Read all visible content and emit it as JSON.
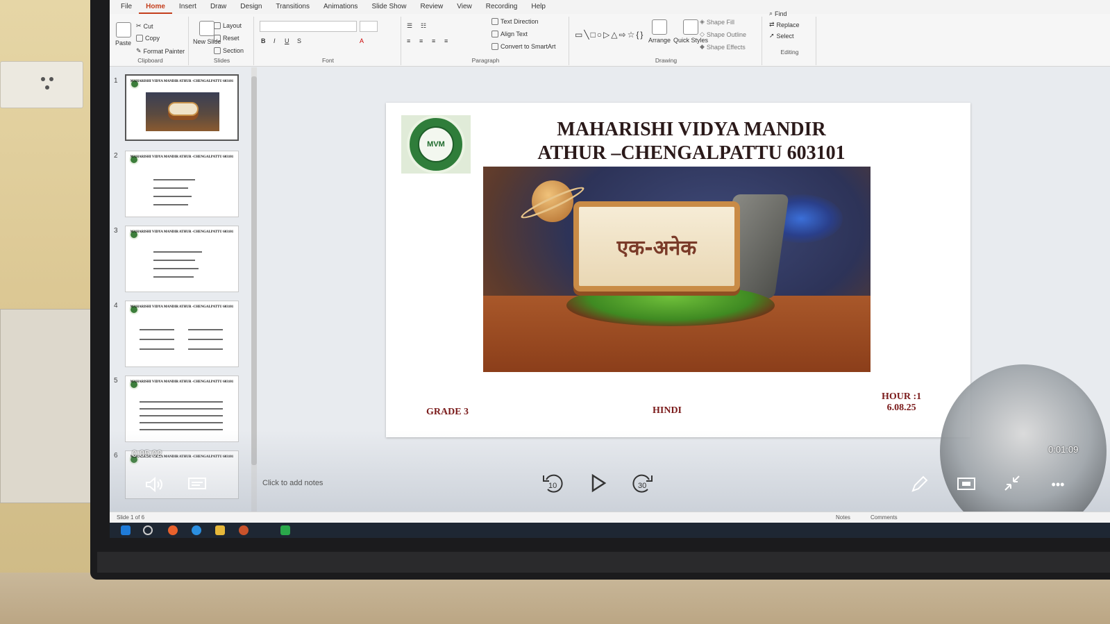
{
  "ribbon": {
    "tabs": [
      "File",
      "Home",
      "Insert",
      "Draw",
      "Design",
      "Transitions",
      "Animations",
      "Slide Show",
      "Review",
      "View",
      "Recording",
      "Help"
    ],
    "clipboard": {
      "paste": "Paste",
      "cut": "Cut",
      "copy": "Copy",
      "format_painter": "Format Painter",
      "label": "Clipboard"
    },
    "slides": {
      "new_slide": "New Slide",
      "layout": "Layout",
      "reset": "Reset",
      "section": "Section",
      "label": "Slides"
    },
    "font": {
      "label": "Font"
    },
    "paragraph": {
      "text_direction": "Text Direction",
      "align_text": "Align Text",
      "convert_smartart": "Convert to SmartArt",
      "label": "Paragraph"
    },
    "drawing": {
      "arrange": "Arrange",
      "quick_styles": "Quick Styles",
      "shape_fill": "Shape Fill",
      "shape_outline": "Shape Outline",
      "shape_effects": "Shape Effects",
      "label": "Drawing"
    },
    "editing": {
      "find": "Find",
      "replace": "Replace",
      "select": "Select",
      "label": "Editing"
    }
  },
  "thumbnails": [
    {
      "num": "1",
      "title": "MAHARISHI VIDYA MANDIR ATHUR -CHENGALPATTU 603101"
    },
    {
      "num": "2",
      "title": "MAHARISHI VIDYA MANDIR ATHUR -CHENGALPATTU 603101"
    },
    {
      "num": "3",
      "title": "MAHARISHI VIDYA MANDIR ATHUR -CHENGALPATTU 603101"
    },
    {
      "num": "4",
      "title": "MAHARISHI VIDYA MANDIR ATHUR -CHENGALPATTU 603101"
    },
    {
      "num": "5",
      "title": "MAHARISHI VIDYA MANDIR ATHUR -CHENGALPATTU 603101"
    },
    {
      "num": "6",
      "title": "MAHARISHI VIDYA MANDIR ATHUR -CHENGALPATTU 603101"
    }
  ],
  "slide": {
    "logo_text": "MVM",
    "title_line1": "MAHARISHI VIDYA MANDIR",
    "title_line2": "ATHUR –CHENGALPATTU 603101",
    "board_text": "एक-अनेक",
    "grade": "GRADE 3",
    "subject": "HINDI",
    "hour": "HOUR :1",
    "date": "6.08.25"
  },
  "notes_placeholder": "Click to add notes",
  "presenter": {
    "elapsed_left": "0:05:02",
    "elapsed_right": "0:01:09",
    "rewind_label": "10",
    "forward_label": "30"
  },
  "statusbar": {
    "slide_count": "Slide 1 of 6",
    "notes": "Notes",
    "comments": "Comments"
  }
}
